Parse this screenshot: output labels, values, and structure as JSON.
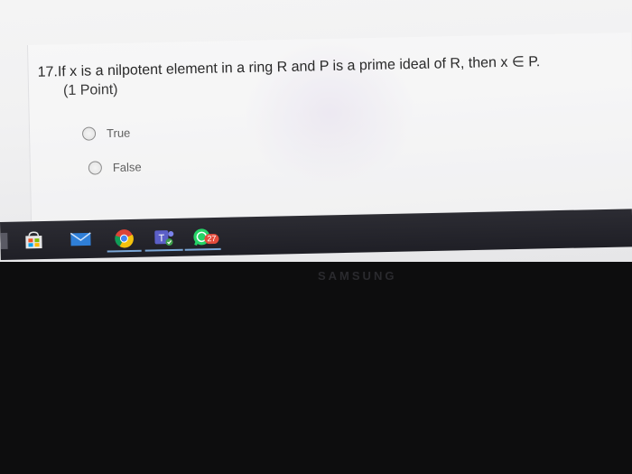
{
  "question": {
    "number": "17.",
    "text": "If x is a nilpotent element in a ring R and P is a prime ideal of R, then x ∈ P.",
    "points": "(1 Point)"
  },
  "options": [
    {
      "label": "True",
      "selected": false
    },
    {
      "label": "False",
      "selected": false
    }
  ],
  "taskbar": {
    "icons": [
      "store-icon",
      "mail-icon",
      "chrome-icon",
      "teams-icon",
      "whatsapp-icon"
    ],
    "whatsapp_badge": "27"
  },
  "bezel": {
    "brand": "SAMSUNG"
  },
  "colors": {
    "screen_bg": "#f3f3f3",
    "taskbar_bg": "#25252c",
    "badge": "#e24b3b",
    "active_underline": "#7aa6d6"
  }
}
